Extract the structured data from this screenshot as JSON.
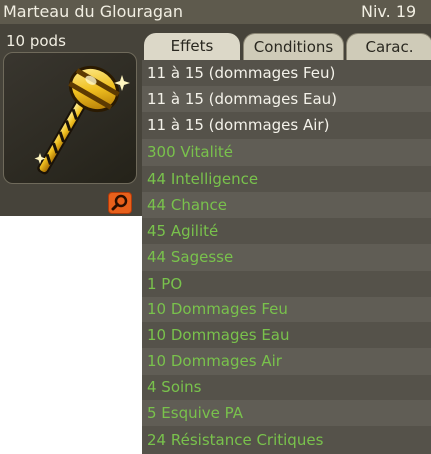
{
  "window": {
    "title": "Marteau du Glouragan",
    "level": "Niv. 19"
  },
  "item": {
    "pods": "10 pods",
    "icon": "golden-hammer-icon",
    "zoom_icon": "magnifier-icon"
  },
  "tabs": [
    {
      "label": "Effets",
      "active": true
    },
    {
      "label": "Conditions",
      "active": false
    },
    {
      "label": "Carac.",
      "active": false
    }
  ],
  "effects": [
    {
      "text": "11 à 15 (dommages Feu)",
      "color": "white"
    },
    {
      "text": "11 à 15 (dommages Eau)",
      "color": "white"
    },
    {
      "text": "11 à 15 (dommages Air)",
      "color": "white"
    },
    {
      "text": "300 Vitalité",
      "color": "green"
    },
    {
      "text": "44 Intelligence",
      "color": "green"
    },
    {
      "text": "44 Chance",
      "color": "green"
    },
    {
      "text": "45 Agilité",
      "color": "green"
    },
    {
      "text": "44 Sagesse",
      "color": "green"
    },
    {
      "text": "1 PO",
      "color": "green"
    },
    {
      "text": "10 Dommages Feu",
      "color": "green"
    },
    {
      "text": "10 Dommages Eau",
      "color": "green"
    },
    {
      "text": "10 Dommages Air",
      "color": "green"
    },
    {
      "text": "4 Soins",
      "color": "green"
    },
    {
      "text": "5 Esquive PA",
      "color": "green"
    },
    {
      "text": "24 Résistance Critiques",
      "color": "green"
    }
  ],
  "colors": {
    "effect_white": "#f4f2ea",
    "effect_green": "#79c24c",
    "zoom_button": "#e8601b"
  }
}
